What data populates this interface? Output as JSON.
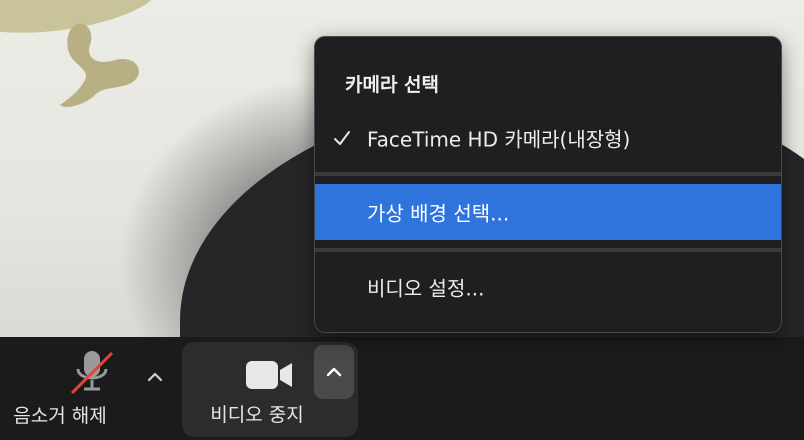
{
  "menu": {
    "header": "카메라 선택",
    "items": [
      {
        "label": "FaceTime HD 카메라(내장형)",
        "checked": true
      },
      {
        "label": "가상 배경 선택...",
        "highlighted": true
      },
      {
        "label": "비디오 설정..."
      }
    ]
  },
  "toolbar": {
    "mute_label": "음소거 해제",
    "video_label": "비디오 중지",
    "icons": [
      "microphone-muted-icon",
      "chevron-up-icon",
      "video-camera-icon",
      "chevron-up-icon"
    ]
  },
  "colors": {
    "highlight": "#2f73dd",
    "menu_bg": "#1f1f21",
    "muted_slash": "#e0443e"
  }
}
